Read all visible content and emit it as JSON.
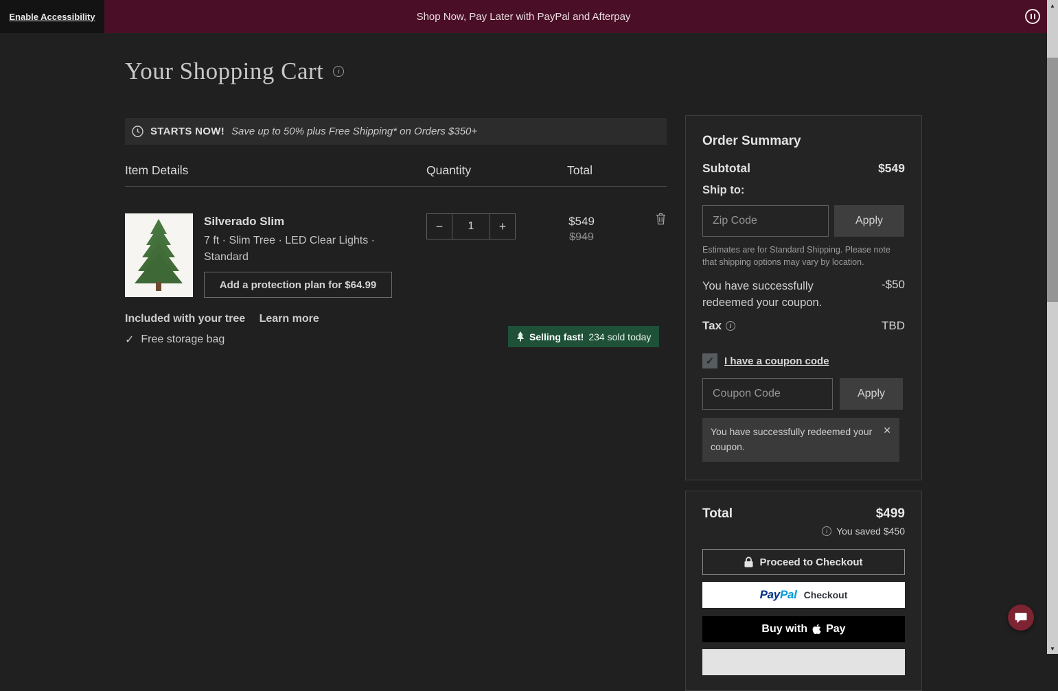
{
  "top": {
    "accessibility_label": "Enable Accessibility",
    "banner_text": "Shop Now, Pay Later with PayPal and Afterpay"
  },
  "page": {
    "title": "Your Shopping Cart"
  },
  "promo": {
    "lead": "STARTS NOW!",
    "detail": "Save up to 50% plus Free Shipping* on Orders $350+"
  },
  "cart": {
    "headers": {
      "item": "Item Details",
      "quantity": "Quantity",
      "total": "Total"
    },
    "item": {
      "name": "Silverado Slim",
      "specs": "7 ft · Slim Tree · LED Clear Lights · Standard",
      "protection_label": "Add a protection plan for $64.99",
      "quantity": "1",
      "price": "$549",
      "original_price": "$949",
      "included_label": "Included with your tree",
      "learn_more_label": "Learn more",
      "included_item": "Free storage bag",
      "badge_bold": "Selling fast!",
      "badge_text": "234 sold today"
    }
  },
  "summary": {
    "title": "Order Summary",
    "subtotal_label": "Subtotal",
    "subtotal_value": "$549",
    "ship_to_label": "Ship to:",
    "zip_placeholder": "Zip Code",
    "zip_apply_label": "Apply",
    "shipping_note": "Estimates are for Standard Shipping. Please note that shipping options may vary by location.",
    "discount_text": "You have successfully redeemed your coupon.",
    "discount_value": "-$50",
    "tax_label": "Tax",
    "tax_value": "TBD",
    "coupon_checkbox_label": "I have a coupon code",
    "coupon_placeholder": "Coupon Code",
    "coupon_apply_label": "Apply",
    "toast_text": "You have successfully redeemed your coupon."
  },
  "totals": {
    "label": "Total",
    "value": "$499",
    "saved_text": "You saved $450",
    "checkout_label": "Proceed to Checkout",
    "paypal_pay": "Pay",
    "paypal_pal": "Pal",
    "paypal_suffix": "Checkout",
    "apple_prefix": "Buy with",
    "apple_suffix": "Pay"
  },
  "icons": {
    "info": "i",
    "check": "✓",
    "close": "✕",
    "minus": "−",
    "plus": "+",
    "scroll_up": "▲",
    "scroll_down": "▼"
  },
  "colors": {
    "top_banner": "#4a0f26",
    "badge_green": "#1e5138",
    "paypal_dark_blue": "#003087",
    "paypal_light_blue": "#009cde",
    "apple_pay_black": "#000000",
    "chat_bubble": "#7d2331"
  }
}
